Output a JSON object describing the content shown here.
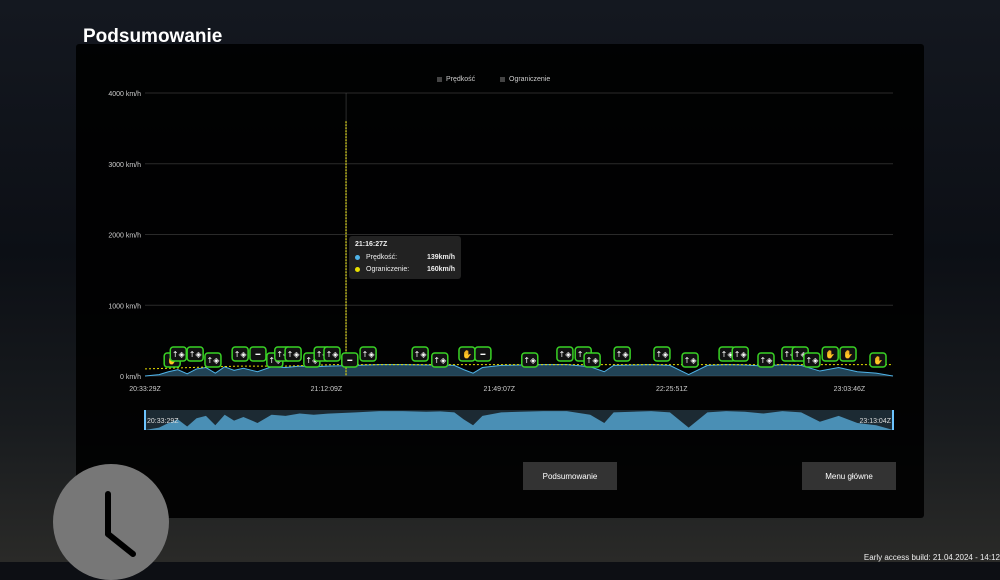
{
  "title": "Podsumowanie",
  "legend": {
    "speed": "Prędkość",
    "limit": "Ograniczenie"
  },
  "colors": {
    "speed": "#4fb3e8",
    "limit": "#e8e000",
    "area": "#2f5f7a",
    "marker": "#39d325"
  },
  "tooltip": {
    "time": "21:16:27Z",
    "speed_label": "Prędkość:",
    "speed_value": "139km/h",
    "limit_label": "Ograniczenie:",
    "limit_value": "160km/h"
  },
  "chart_data": {
    "type": "area",
    "title": "",
    "ylabel": "",
    "xlabel": "",
    "ylim": [
      0,
      4000
    ],
    "yticks": [
      "0 km/h",
      "1000 km/h",
      "2000 km/h",
      "3000 km/h",
      "4000 km/h"
    ],
    "xticks": [
      "20:33:29Z",
      "21:12:09Z",
      "21:49:07Z",
      "22:25:51Z",
      "23:03:46Z"
    ],
    "xtick_min": [
      0,
      38.7,
      75.6,
      112.4,
      150.3
    ],
    "x_range_min": [
      0,
      159.6
    ],
    "series": [
      {
        "name": "Prędkość",
        "t_min": [
          0,
          3,
          5,
          7,
          9,
          11,
          13,
          15,
          17,
          19,
          21,
          24,
          27,
          30,
          33,
          36,
          39,
          42,
          45,
          50,
          55,
          60,
          63,
          66,
          68,
          70,
          72,
          76,
          80,
          85,
          90,
          95,
          98,
          100,
          104,
          108,
          112,
          116,
          120,
          124,
          128,
          132,
          136,
          140,
          144,
          148,
          152,
          156,
          159.6
        ],
        "values": [
          0,
          20,
          60,
          90,
          30,
          100,
          120,
          40,
          130,
          80,
          110,
          60,
          130,
          120,
          140,
          130,
          139,
          145,
          150,
          160,
          160,
          155,
          158,
          150,
          90,
          40,
          120,
          150,
          155,
          160,
          160,
          130,
          60,
          150,
          155,
          160,
          150,
          20,
          150,
          160,
          155,
          140,
          160,
          150,
          70,
          120,
          60,
          40,
          0
        ]
      },
      {
        "name": "Ograniczenie",
        "t_min": [
          0,
          10,
          20,
          30,
          40,
          50,
          60,
          70,
          80,
          90,
          100,
          110,
          120,
          130,
          140,
          150,
          159.6
        ],
        "values": [
          100,
          120,
          140,
          140,
          160,
          160,
          160,
          160,
          160,
          160,
          160,
          160,
          160,
          160,
          160,
          160,
          160
        ]
      }
    ],
    "vertical_marker_min": 42.9,
    "vertical_marker_value": 3600,
    "range_selector": {
      "start": "20:33:29Z",
      "end": "23:13:04Z"
    },
    "events": [
      {
        "t": 5.8,
        "type": "hand"
      },
      {
        "t": 7.1,
        "type": "shield"
      },
      {
        "t": 10.7,
        "type": "shield"
      },
      {
        "t": 14.5,
        "type": "shield"
      },
      {
        "t": 20.3,
        "type": "shield"
      },
      {
        "t": 24.1,
        "type": "horn"
      },
      {
        "t": 27.7,
        "type": "shield"
      },
      {
        "t": 29.4,
        "type": "shield"
      },
      {
        "t": 31.6,
        "type": "shield"
      },
      {
        "t": 35.6,
        "type": "shield"
      },
      {
        "t": 37.8,
        "type": "shield"
      },
      {
        "t": 39.9,
        "type": "shield"
      },
      {
        "t": 43.7,
        "type": "horn"
      },
      {
        "t": 47.6,
        "type": "shield"
      },
      {
        "t": 58.7,
        "type": "shield"
      },
      {
        "t": 62.9,
        "type": "shield"
      },
      {
        "t": 68.7,
        "type": "hand"
      },
      {
        "t": 72.1,
        "type": "horn"
      },
      {
        "t": 82.1,
        "type": "shield"
      },
      {
        "t": 89.6,
        "type": "shield"
      },
      {
        "t": 93.5,
        "type": "shield"
      },
      {
        "t": 95.4,
        "type": "shield"
      },
      {
        "t": 101.8,
        "type": "shield"
      },
      {
        "t": 110.3,
        "type": "shield"
      },
      {
        "t": 116.3,
        "type": "shield"
      },
      {
        "t": 124.2,
        "type": "shield"
      },
      {
        "t": 127.0,
        "type": "shield"
      },
      {
        "t": 132.5,
        "type": "shield"
      },
      {
        "t": 137.6,
        "type": "shield"
      },
      {
        "t": 139.8,
        "type": "shield"
      },
      {
        "t": 142.3,
        "type": "shield"
      },
      {
        "t": 146.2,
        "type": "hand"
      },
      {
        "t": 150.0,
        "type": "hand"
      },
      {
        "t": 156.4,
        "type": "hand"
      }
    ]
  },
  "buttons": {
    "summary": "Podsumowanie",
    "main_menu": "Menu główne"
  },
  "build": "Early access build: 21.04.2024 - 14:12"
}
